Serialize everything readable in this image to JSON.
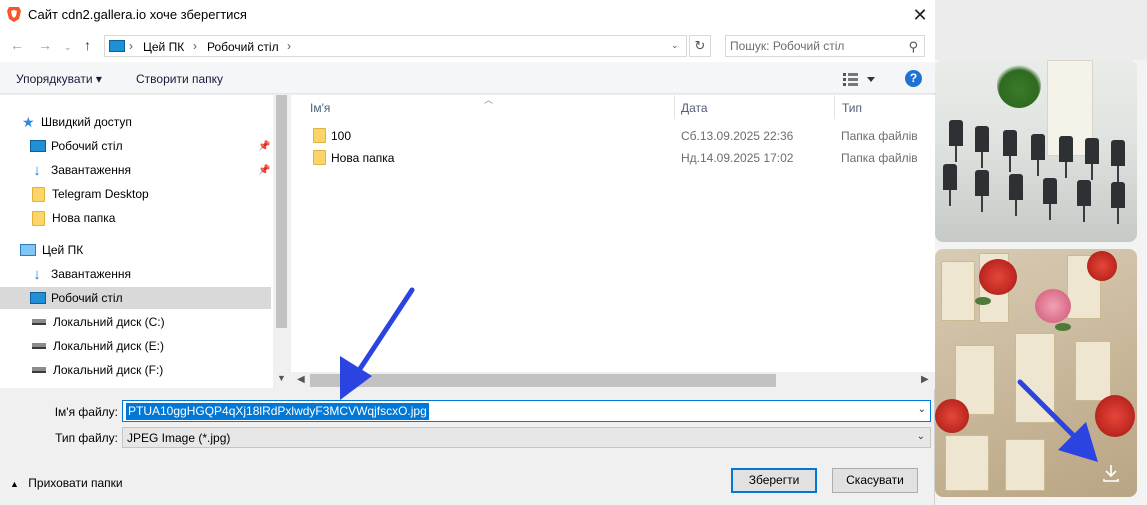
{
  "dialog": {
    "title": "Сайт cdn2.gallera.io хоче зберегтися",
    "close_label": "✕"
  },
  "address": {
    "crumbs": [
      "Цей ПК",
      "Робочий стіл"
    ],
    "search_placeholder": "Пошук: Робочий стіл"
  },
  "toolbar": {
    "organize": "Упорядкувати ▾",
    "new_folder": "Створити папку"
  },
  "nav": {
    "items": [
      {
        "label": "Швидкий доступ",
        "icon": "star-icon"
      },
      {
        "label": "Робочий стіл",
        "icon": "desktop-icon",
        "pinned": true
      },
      {
        "label": "Завантаження",
        "icon": "download-icon",
        "pinned": true
      },
      {
        "label": "Telegram Desktop",
        "icon": "folder-icon"
      },
      {
        "label": "Нова папка",
        "icon": "folder-icon"
      },
      {
        "label": "Цей ПК",
        "icon": "computer-icon"
      },
      {
        "label": "Завантаження",
        "icon": "download-icon"
      },
      {
        "label": "Робочий стіл",
        "icon": "desktop-icon",
        "selected": true
      },
      {
        "label": "Локальний диск (C:)",
        "icon": "drive-icon"
      },
      {
        "label": "Локальний диск (E:)",
        "icon": "drive-icon"
      },
      {
        "label": "Локальний диск (F:)",
        "icon": "drive-icon"
      }
    ]
  },
  "filelist": {
    "columns": [
      "Ім'я",
      "Дата",
      "Тип"
    ],
    "rows": [
      {
        "name": "100",
        "date": "Сб.13.09.2025 22:36",
        "type": "Папка файлів"
      },
      {
        "name": "Нова папка",
        "date": "Нд.14.09.2025 17:02",
        "type": "Папка файлів"
      }
    ]
  },
  "save": {
    "filename_label": "Ім'я файлу:",
    "filename_value": "PTUA10ggHGQP4qXj18lRdPxlwdyF3MCVWqjfscxO.jpg",
    "type_label": "Тип файлу:",
    "type_value": "JPEG Image (*.jpg)",
    "hide_folders": "Приховати папки",
    "save_button": "Зберегти",
    "cancel_button": "Скасувати"
  },
  "colors": {
    "accent": "#0078d7",
    "annotation_arrow": "#2b43e0"
  }
}
